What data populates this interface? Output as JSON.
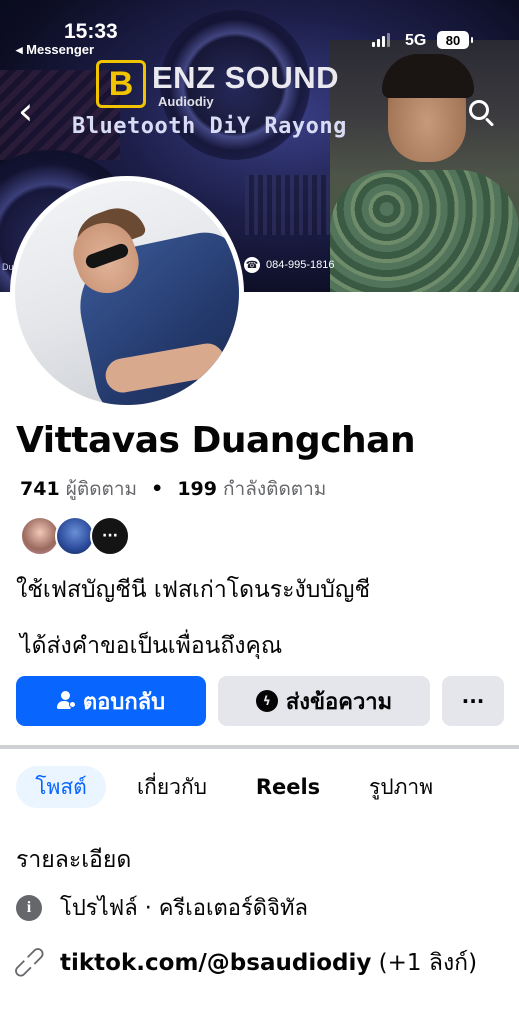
{
  "status_bar": {
    "time": "15:33",
    "back_app": "◂ Messenger",
    "network": "5G",
    "battery": "80"
  },
  "cover": {
    "brand_logo": "B",
    "brand_title": "ENZ SOUND",
    "brand_sub": "Audiodiy",
    "brand_tagline": "Bluetooth DiY Rayong",
    "phone": "084-995-1816",
    "phone_icon": "phone-icon",
    "corner_text": "Dua"
  },
  "profile": {
    "name": "Vittavas Duangchan",
    "followers_count": "741",
    "followers_label": "ผู้ติดตาม",
    "following_count": "199",
    "following_label": "กำลังติดตาม",
    "mutual_more": "···",
    "bio": "ใช้เฟสบัญชีนี เฟสเก่าโดนระงับบัญชี",
    "request_text": "ได้ส่งคำขอเป็นเพื่อนถึงคุณ"
  },
  "buttons": {
    "reply_label": "ตอบกลับ",
    "message_label": "ส่งข้อความ",
    "more_label": "···"
  },
  "tabs": [
    {
      "label": "โพสต์",
      "active": true
    },
    {
      "label": "เกี่ยวกับ",
      "active": false
    },
    {
      "label": "Reels",
      "active": false
    },
    {
      "label": "รูปภาพ",
      "active": false
    }
  ],
  "details": {
    "heading": "รายละเอียด",
    "profile_type": "โปรไฟล์ · ครีเอเตอร์ดิจิทัล",
    "link_main": "tiktok.com/@bsaudiodiy",
    "link_extra": " (+1 ลิงก์)"
  },
  "colors": {
    "accent": "#0866ff",
    "secondary_button": "#e4e6eb",
    "muted_text": "#65676b"
  }
}
